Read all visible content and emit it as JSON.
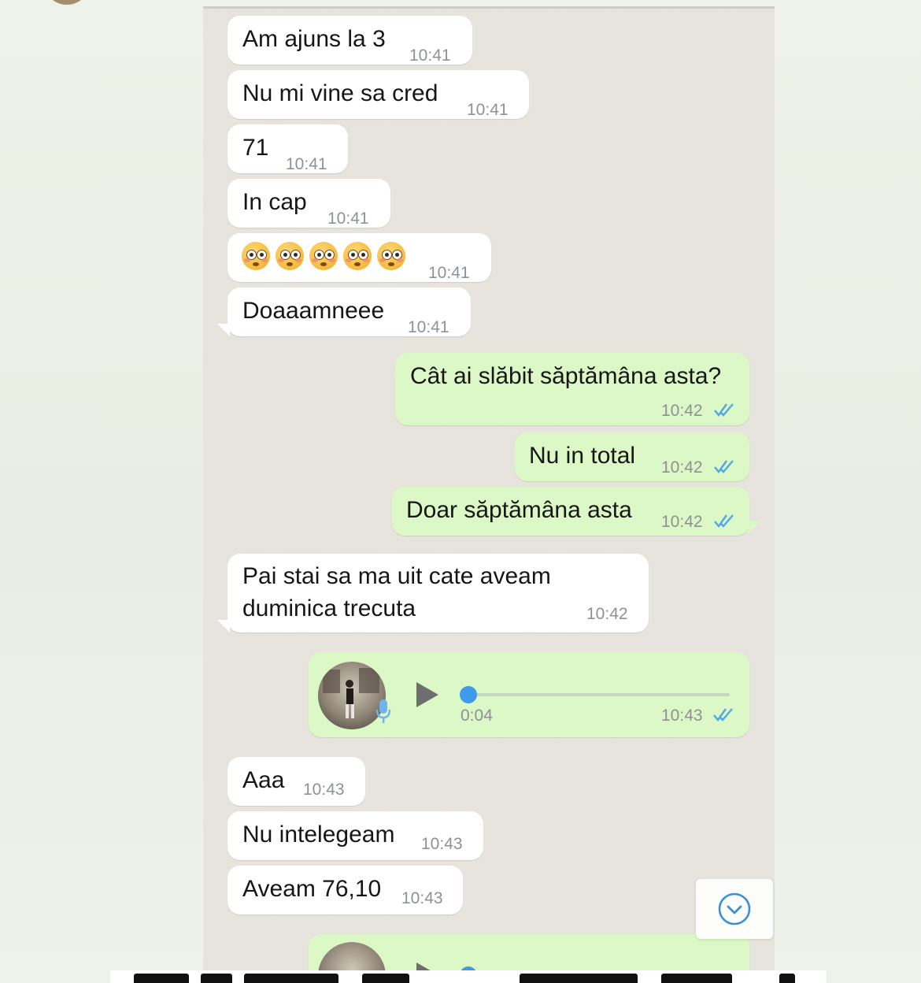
{
  "chat": {
    "messages": [
      {
        "dir": "in",
        "text": "Am ajuns la 3",
        "time": "10:41"
      },
      {
        "dir": "in",
        "text": "Nu mi vine sa cred",
        "time": "10:41"
      },
      {
        "dir": "in",
        "text": "71",
        "time": "10:41"
      },
      {
        "dir": "in",
        "text": "In cap",
        "time": "10:41"
      },
      {
        "dir": "in",
        "emoji": "flushed-face x5",
        "time": "10:41"
      },
      {
        "dir": "in",
        "text": "Doaaamneee",
        "time": "10:41"
      },
      {
        "dir": "out",
        "text": "Cât ai slăbit săptămâna asta?",
        "time": "10:42",
        "status": "read"
      },
      {
        "dir": "out",
        "text": "Nu in total",
        "time": "10:42",
        "status": "read"
      },
      {
        "dir": "out",
        "text": "Doar săptămâna asta",
        "time": "10:42",
        "status": "read"
      },
      {
        "dir": "in",
        "text_line1": "Pai stai sa ma uit cate aveam",
        "text_line2": "duminica trecuta",
        "time": "10:42"
      },
      {
        "dir": "out",
        "type": "voice",
        "duration": "0:04",
        "time": "10:43",
        "status": "read"
      },
      {
        "dir": "in",
        "text": "Aaa",
        "time": "10:43"
      },
      {
        "dir": "in",
        "text": "Nu intelegeam",
        "time": "10:43"
      },
      {
        "dir": "in",
        "text": "Aveam 76,10",
        "time": "10:43"
      }
    ]
  },
  "icons": {
    "read_receipt": "double-check-icon",
    "play": "play-icon",
    "mic": "microphone-icon",
    "scroll_down": "chevron-down-circle-icon"
  },
  "colors": {
    "incoming_bubble": "#ffffff",
    "outgoing_bubble": "#dcf8c6",
    "read_ticks": "#4fa8e8",
    "chat_background": "#e7e4de"
  }
}
